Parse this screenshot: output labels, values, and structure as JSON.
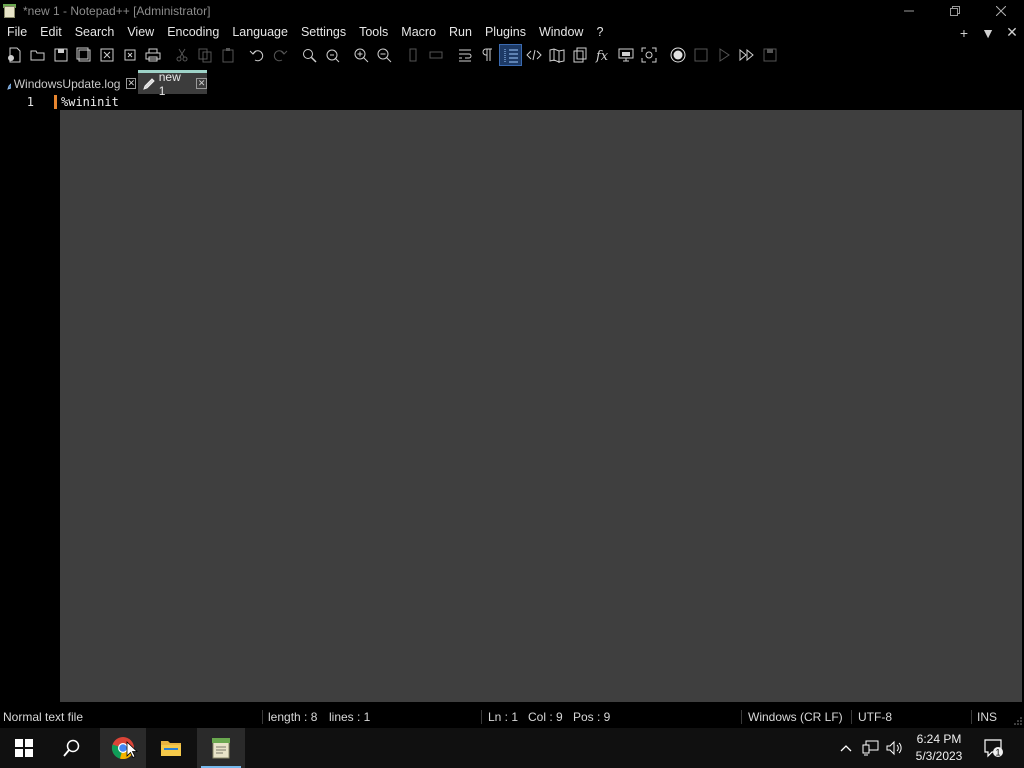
{
  "window": {
    "title": "*new 1 - Notepad++ [Administrator]"
  },
  "menu": {
    "items": [
      "File",
      "Edit",
      "Search",
      "View",
      "Encoding",
      "Language",
      "Settings",
      "Tools",
      "Macro",
      "Run",
      "Plugins",
      "Window",
      "?"
    ]
  },
  "tabs": [
    {
      "label": "WindowsUpdate.log",
      "active": false
    },
    {
      "label": "new 1",
      "active": true
    }
  ],
  "editor": {
    "lines": [
      {
        "number": "1",
        "text": "%wininit"
      }
    ]
  },
  "status": {
    "file_type": "Normal text file",
    "length": "length : 8",
    "lines": "lines : 1",
    "ln": "Ln : 1",
    "col": "Col : 9",
    "pos": "Pos : 9",
    "eol": "Windows (CR LF)",
    "encoding": "UTF-8",
    "mode": "INS"
  },
  "taskbar": {
    "time": "6:24 PM",
    "date": "5/3/2023",
    "notification_count": "1"
  },
  "colors": {
    "editor_bg": "#3f3f3f",
    "gutter_bg": "#000000",
    "active_tab_accent": "#9ed3c8",
    "fold_marker": "#e8862f",
    "taskbar_accent": "#76b9ed"
  },
  "icons": {
    "toolbar": [
      "new-file-icon",
      "open-file-icon",
      "save-icon",
      "save-all-icon",
      "close-icon",
      "close-all-icon",
      "print-icon",
      "cut-icon",
      "copy-icon",
      "paste-icon",
      "undo-icon",
      "redo-icon",
      "find-icon",
      "replace-icon",
      "zoom-in-icon",
      "zoom-out-icon",
      "sync-vertical-icon",
      "sync-horizontal-icon",
      "word-wrap-icon",
      "show-all-chars-icon",
      "indent-guide-icon",
      "xml-tag-icon",
      "document-map-icon",
      "document-list-icon",
      "function-list-icon",
      "folder-as-workspace-icon",
      "monitoring-icon",
      "record-macro-icon",
      "stop-macro-icon",
      "play-macro-icon",
      "run-macro-multiple-icon",
      "save-macro-icon"
    ]
  }
}
